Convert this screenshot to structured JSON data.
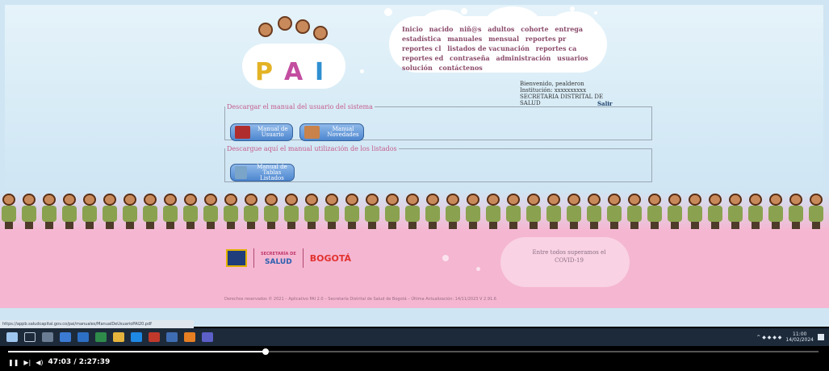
{
  "logo": {
    "text": "PAI",
    "letters": [
      "P",
      "A",
      "I"
    ],
    "letter_colors": [
      "#e3b325",
      "#c34ea0",
      "#2f8fd0"
    ]
  },
  "nav": {
    "items": [
      "Inicio",
      "nacido",
      "niñ@s",
      "adultos",
      "cohorte",
      "entrega",
      "estadística",
      "manuales",
      "mensual",
      "reportes pr",
      "reportes cl",
      "listados de vacunación",
      "reportes ca",
      "reportes ed",
      "contraseña",
      "administración",
      "usuarios",
      "solución",
      "contáctenos"
    ]
  },
  "user": {
    "welcome": "Bienvenido, pealderon",
    "institution": "Institución: xxxxxxxxxx",
    "org": "SECRETARIA DISTRITAL DE SALUD",
    "logout": "Salir"
  },
  "manual_box": {
    "legend": "Descargar el manual del usuario del sistema",
    "buttons": [
      {
        "label": "Manual de Usuario"
      },
      {
        "label": "Manual Novedades"
      }
    ]
  },
  "listados_box": {
    "legend": "Descargue aquí el manual utilización de los listados",
    "buttons": [
      {
        "label": "Manual de Tablas Listados"
      }
    ]
  },
  "footer": {
    "salud": "SALUD",
    "secretaria": "SECRETARÍA DE",
    "bogota": "BOGOTÁ",
    "message": "Entre todos superamos el COVID-19",
    "copyright": "Derechos reservados © 2021 – Aplicativo PAI 2.0 – Secretaría Distrital de Salud de Bogotá – Última Actualización: 14/11/2023 V 2.91.6"
  },
  "status_url": "https://appb.saludcapital.gov.co/pai/manuales/ManualDeUsuarioPAI20.pdf",
  "taskbar": {
    "time": "11:00",
    "date": "14/02/2024"
  },
  "video": {
    "time": "47:03 / 2:27:39",
    "progress": 0.318
  },
  "colors": {
    "pink": "#f5b6d1",
    "sky": "#cfe5f3",
    "taskbar": "#1d2a3a"
  }
}
